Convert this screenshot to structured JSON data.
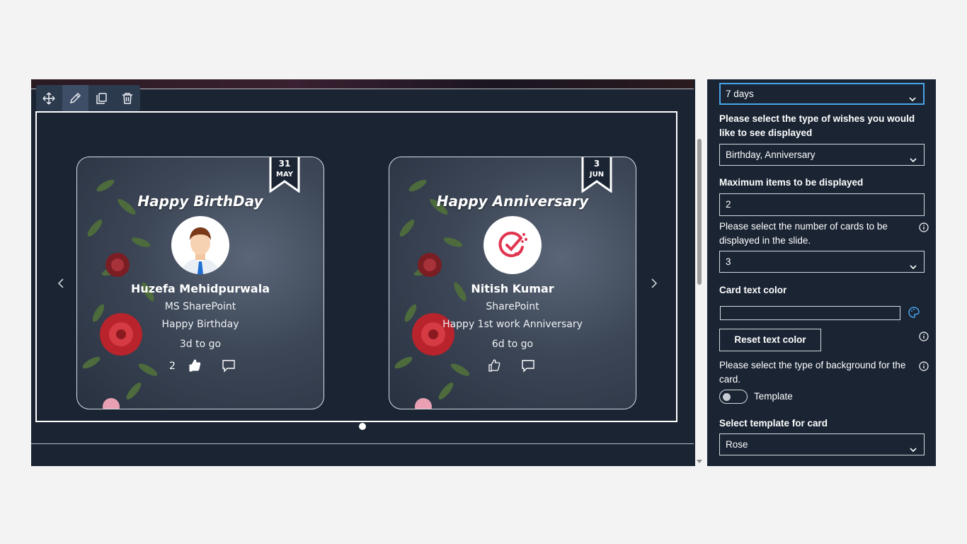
{
  "toolbar": {
    "move": "move-icon",
    "edit": "edit-icon",
    "duplicate": "duplicate-icon",
    "delete": "delete-icon"
  },
  "cards": [
    {
      "ribbon_day": "31",
      "ribbon_month": "MAY",
      "title": "Happy BirthDay",
      "name": "Huzefa Mehidpurwala",
      "line1": "MS SharePoint",
      "line2": "Happy Birthday",
      "line3": "3d to go",
      "likes": "2"
    },
    {
      "ribbon_day": "3",
      "ribbon_month": "JUN",
      "title": "Happy Anniversary",
      "name": "Nitish Kumar",
      "line1": "SharePoint",
      "line2": "Happy 1st work Anniversary",
      "line3": "6d to go",
      "likes": ""
    }
  ],
  "panel": {
    "days_value": "7 days",
    "wishes_label": "Please select the type of wishes you would like to see displayed",
    "wishes_value": "Birthday, Anniversary",
    "max_items_label": "Maximum items to be displayed",
    "max_items_value": "2",
    "cards_count_label": "Please select the number of cards to be displayed in the slide.",
    "cards_count_value": "3",
    "text_color_label": "Card text color",
    "text_color_value": "",
    "reset_button": "Reset text color",
    "background_label": "Please select the type of background for the card.",
    "toggle_label": "Template",
    "template_label": "Select template for card",
    "template_value": "Rose"
  },
  "colors": {
    "canvas": "#1a2433",
    "accent": "#4aa3e8",
    "panel": "#1a2433"
  }
}
